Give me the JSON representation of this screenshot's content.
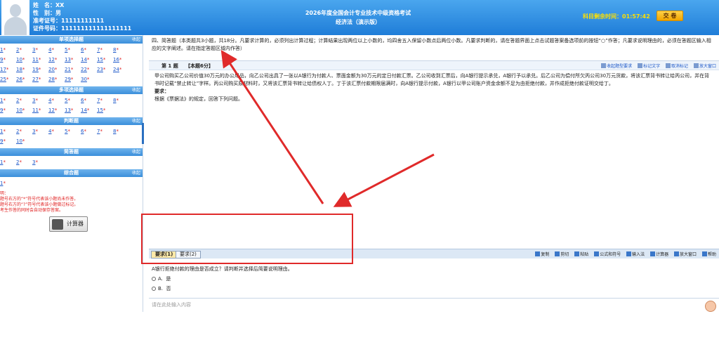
{
  "header": {
    "name_label": "姓　名：",
    "name_value": "XX",
    "gender_label": "性　别：",
    "gender_value": "男",
    "ticket_label": "准考证号：",
    "ticket_value": "11111111111",
    "id_label": "证件号码：",
    "id_value": "111111111111111111",
    "exam_title": "2026年度全国会计专业技术中级资格考试",
    "exam_subject": "经济法（演示版）",
    "timer_label": "科目剩余时间：",
    "timer_value": "01:57:42",
    "submit_label": "交 卷"
  },
  "left_panel": {
    "sections": [
      {
        "title": "单项选择题",
        "collapse": "收起",
        "items": [
          "1",
          "2",
          "3",
          "4",
          "5",
          "6",
          "7",
          "8",
          "9",
          "10",
          "11",
          "12",
          "13",
          "14",
          "15",
          "16",
          "17",
          "18",
          "19",
          "20",
          "21",
          "22",
          "23",
          "24",
          "25",
          "26",
          "27",
          "28",
          "29",
          "30"
        ]
      },
      {
        "title": "多项选择题",
        "collapse": "收起",
        "items": [
          "1",
          "2",
          "3",
          "4",
          "5",
          "6",
          "7",
          "8",
          "9",
          "10",
          "11",
          "12",
          "13",
          "14",
          "15"
        ]
      },
      {
        "title": "判断题",
        "collapse": "收起",
        "items": [
          "1",
          "2",
          "3",
          "4",
          "5",
          "6",
          "7",
          "8",
          "9",
          "10"
        ]
      },
      {
        "title": "简答题",
        "collapse": "收起",
        "items": [
          "1",
          "2",
          "3"
        ]
      },
      {
        "title": "综合题",
        "collapse": "收起",
        "items": [
          "1"
        ]
      }
    ],
    "notes": [
      "明：",
      "题号右方的“*”符号代表该小题尚未作答。",
      "题号右方的“?”符号代表该小题做过标记。",
      "考生作答的同时会自动保存答案。"
    ],
    "calculator_label": "计算器"
  },
  "instructions": "四、简答题（本类题共3小题，共18分。凡要求计算的，必须列出计算过程；计算结果出现两位以上小数的，均四舍五入保留小数点后两位小数。凡要求判断的，请在答题界面上点击试题答案备选项前的按钮“○”作答；凡要求说明理由的，必须在答题区输入相应的文字阐述。请在指定答题区域内作答）",
  "question": {
    "number": "第 1 题",
    "score": "【本题6分】",
    "tools": [
      "收起题型要求",
      "标记文字",
      "取消标记",
      "放大窗口"
    ],
    "body": [
      "甲公司购买乙公司价值30万元的办公用品，向乙公司出具了一张以A银行为付款人、票面金额为30万元的定日付款汇票。乙公司收到汇票后，向A银行提示承兑，A银行予以承兑。后乙公司为偿付所欠丙公司30万元货款，将该汇票背书转让给丙公司，并在背书时记载“禁止转让”字样。丙公司购买原材料时，又将该汇票背书转让给债权人丁。丁于该汇票付款期限届满时，向A银行提示付款，A银行以甲公司账户资金余额不足为由拒绝付款，并作成拒绝付款证明交给丁。",
      "要求：",
      "根据《票据法》的规定，回答下列问题。"
    ]
  },
  "answer": {
    "tabs": [
      "要求(1)",
      "要求(2)"
    ],
    "tools": [
      "复制",
      "剪切",
      "粘贴",
      "公式和符号",
      "输入法",
      "计算器",
      "放大窗口",
      "帮助"
    ],
    "sub_question": "A银行拒绝付款的理由是否成立？请判断并选择后简要说明理由。",
    "options": [
      {
        "key": "A.",
        "text": "是"
      },
      {
        "key": "B.",
        "text": "否"
      }
    ],
    "input_placeholder": "请在此处输入内容"
  },
  "colors": {
    "header_blue": "#2b8be0",
    "highlight_red": "#e02a2a",
    "timer_yellow": "#ffe000"
  }
}
